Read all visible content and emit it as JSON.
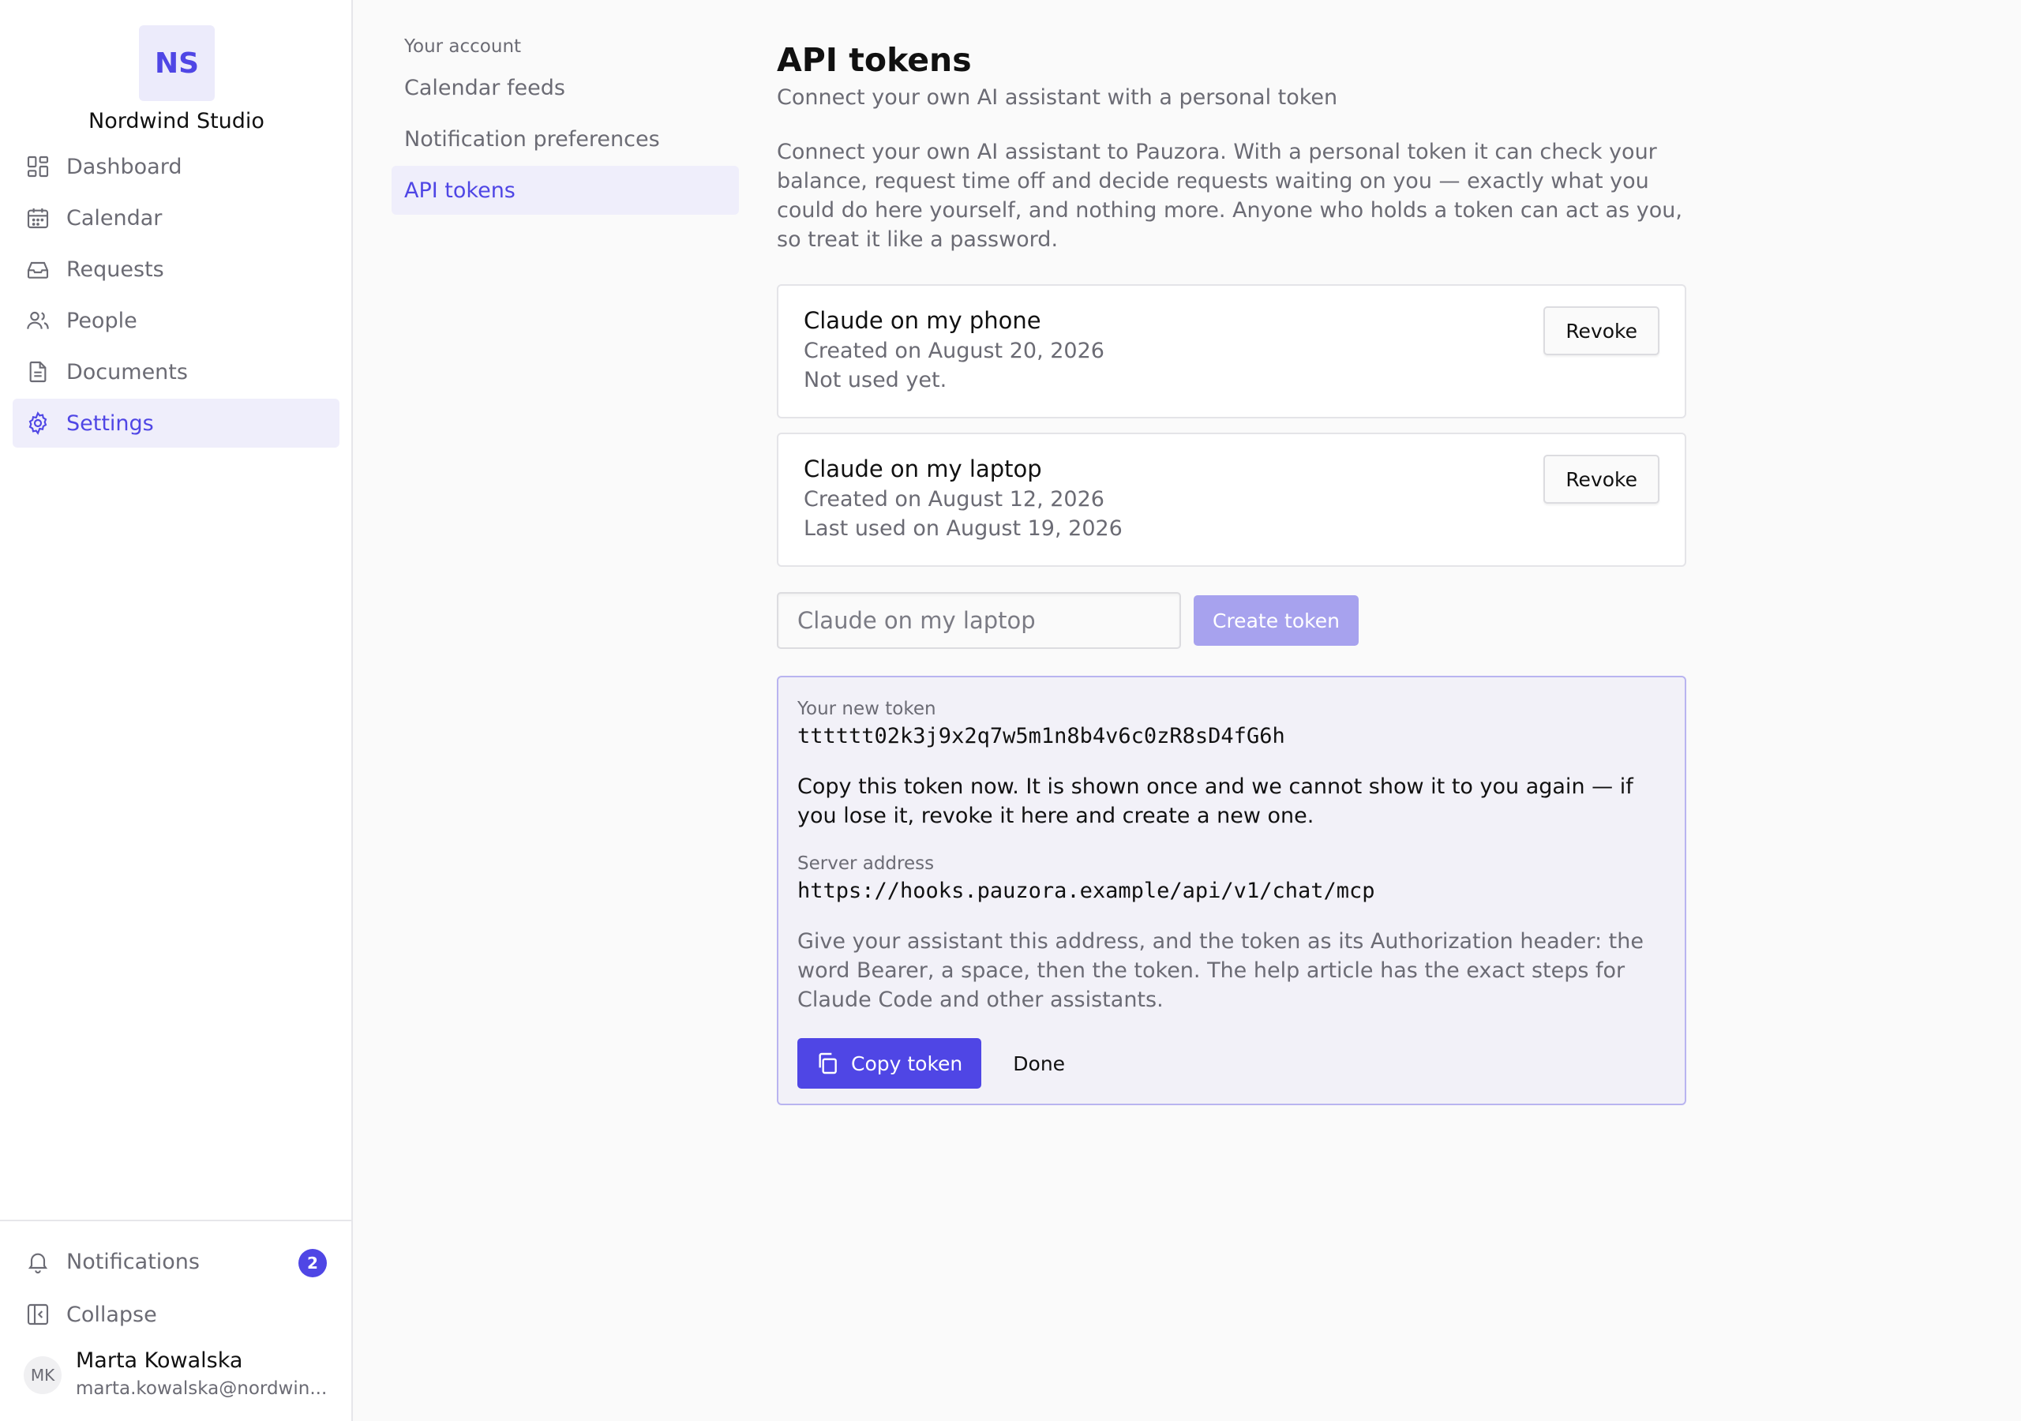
{
  "sidebar": {
    "org_initials": "NS",
    "org_name": "Nordwind Studio",
    "items": [
      {
        "label": "Dashboard",
        "icon": "dashboard-icon"
      },
      {
        "label": "Calendar",
        "icon": "calendar-icon"
      },
      {
        "label": "Requests",
        "icon": "inbox-icon"
      },
      {
        "label": "People",
        "icon": "people-icon"
      },
      {
        "label": "Documents",
        "icon": "document-icon"
      },
      {
        "label": "Settings",
        "icon": "gear-icon",
        "active": true
      }
    ],
    "notifications_label": "Notifications",
    "notifications_count": "2",
    "collapse_label": "Collapse",
    "user": {
      "initials": "MK",
      "name": "Marta Kowalska",
      "email": "marta.kowalska@nordwin..."
    }
  },
  "subnav": {
    "heading": "Your account",
    "items": [
      {
        "label": "Calendar feeds"
      },
      {
        "label": "Notification preferences"
      },
      {
        "label": "API tokens",
        "active": true
      }
    ]
  },
  "main": {
    "title": "API tokens",
    "subtitle": "Connect your own AI assistant with a personal token",
    "intro": "Connect your own AI assistant to Pauzora. With a personal token it can check your balance, request time off and decide requests waiting on you — exactly what you could do here yourself, and nothing more. Anyone who holds a token can act as you, so treat it like a password.",
    "tokens": [
      {
        "name": "Claude on my phone",
        "created": "Created on August 20, 2026",
        "usage": "Not used yet.",
        "revoke_label": "Revoke"
      },
      {
        "name": "Claude on my laptop",
        "created": "Created on August 12, 2026",
        "usage": "Last used on August 19, 2026",
        "revoke_label": "Revoke"
      }
    ],
    "create": {
      "placeholder": "Claude on my laptop",
      "button_label": "Create token"
    },
    "new_token": {
      "label": "Your new token",
      "value": "tttttt02k3j9x2q7w5m1n8b4v6c0zR8sD4fG6h",
      "warning": "Copy this token now. It is shown once and we cannot show it to you again — if you lose it, revoke it here and create a new one.",
      "server_label": "Server address",
      "server_value": "https://hooks.pauzora.example/api/v1/chat/mcp",
      "help": "Give your assistant this address, and the token as its Authorization header: the word Bearer, a space, then the token. The help article has the exact steps for Claude Code and other assistants.",
      "copy_label": "Copy token",
      "done_label": "Done"
    }
  },
  "colors": {
    "accent": "#4f46e5",
    "accent_soft": "#efeefb",
    "accent_disabled": "#a7a2ee",
    "text_muted": "#6b6b74"
  }
}
